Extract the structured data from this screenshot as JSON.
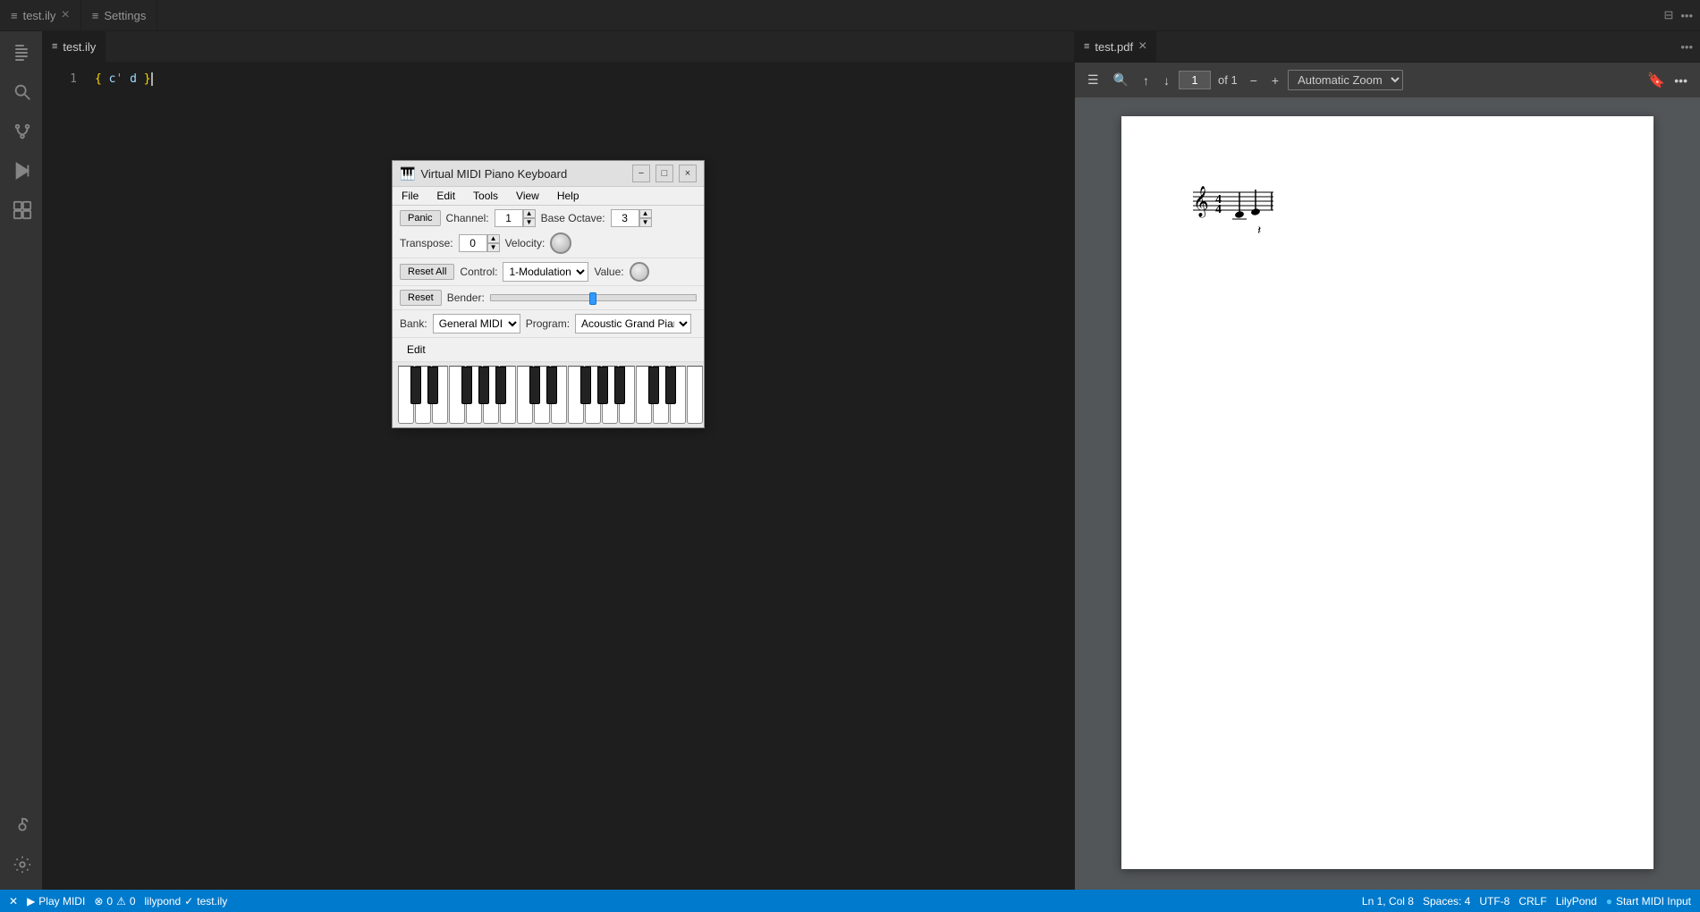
{
  "tabs": [
    {
      "id": "test-ily-tab",
      "label": "test.ily",
      "icon": "≡",
      "active": false,
      "dirty": false
    },
    {
      "id": "settings-tab",
      "label": "Settings",
      "icon": "≡",
      "active": false,
      "dirty": false
    }
  ],
  "editor": {
    "filename": "test.ily",
    "breadcrumb": "test.ily",
    "lines": [
      {
        "num": "1",
        "content": "{ c' d }"
      }
    ]
  },
  "pdf": {
    "filename": "test.pdf",
    "toolbar": {
      "page_input": "1",
      "page_of": "of 1",
      "zoom_label": "Automatic Zoom"
    }
  },
  "midi_dialog": {
    "title": "Virtual MIDI Piano Keyboard",
    "menu": [
      "File",
      "Edit",
      "Tools",
      "View",
      "Help"
    ],
    "panic_label": "Panic",
    "channel_label": "Channel:",
    "channel_value": "1",
    "base_octave_label": "Base Octave:",
    "base_octave_value": "3",
    "transpose_label": "Transpose:",
    "transpose_value": "0",
    "velocity_label": "Velocity:",
    "reset_all_label": "Reset All",
    "control_label": "Control:",
    "control_value": "1-Modulation",
    "value_label": "Value:",
    "reset_label": "Reset",
    "bender_label": "Bender:",
    "bank_label": "Bank:",
    "bank_value": "General MIDI",
    "program_label": "Program:",
    "program_value": "Acoustic Grand Piano",
    "edit_label": "Edit"
  },
  "status_bar": {
    "play_midi": "Play MIDI",
    "errors": "0",
    "warnings": "0",
    "lilypond": "lilypond",
    "check": "✓",
    "filename": "test.ily",
    "position": "Ln 1, Col 8",
    "spaces": "Spaces: 4",
    "encoding": "UTF-8",
    "line_ending": "CRLF",
    "language": "LilyPond",
    "notification": "Start MIDI Input"
  },
  "activity_icons": [
    {
      "id": "files",
      "symbol": "⊞",
      "active": false
    },
    {
      "id": "search",
      "symbol": "🔍",
      "active": false
    },
    {
      "id": "source-control",
      "symbol": "⑂",
      "active": false
    },
    {
      "id": "run",
      "symbol": "▶",
      "active": false
    },
    {
      "id": "extensions",
      "symbol": "⊟",
      "active": false
    },
    {
      "id": "lilypond",
      "symbol": "🎵",
      "active": false
    },
    {
      "id": "terminal",
      "symbol": "✉",
      "active": false
    }
  ]
}
